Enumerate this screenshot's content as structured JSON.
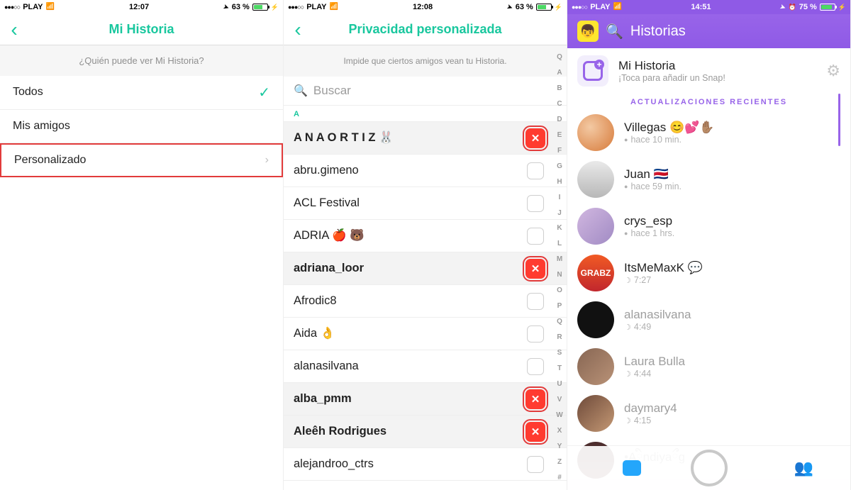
{
  "phone1": {
    "status": {
      "carrier": "PLAY",
      "time": "12:07",
      "battery_pct": "63 %",
      "battery_fill": 63
    },
    "nav_title": "Mi Historia",
    "subheader": "¿Quién puede ver Mi Historia?",
    "options": {
      "everyone": "Todos",
      "friends": "Mis amigos",
      "custom": "Personalizado"
    }
  },
  "phone2": {
    "status": {
      "carrier": "PLAY",
      "time": "12:08",
      "battery_pct": "63 %",
      "battery_fill": 63
    },
    "nav_title": "Privacidad personalizada",
    "subheader": "Impide que ciertos amigos vean tu Historia.",
    "search_placeholder": "Buscar",
    "section_letter": "A",
    "friends": [
      {
        "name": "A N A O R T I Z 🐰",
        "blocked": true,
        "highlight": true
      },
      {
        "name": "abru.gimeno",
        "blocked": false,
        "highlight": false
      },
      {
        "name": "ACL Festival",
        "blocked": false,
        "highlight": false
      },
      {
        "name": "ADRIA 🍎 🐻",
        "blocked": false,
        "highlight": false
      },
      {
        "name": "adriana_loor",
        "blocked": true,
        "highlight": true
      },
      {
        "name": "Afrodic8",
        "blocked": false,
        "highlight": false
      },
      {
        "name": "Aida 👌",
        "blocked": false,
        "highlight": false
      },
      {
        "name": "alanasilvana",
        "blocked": false,
        "highlight": false
      },
      {
        "name": "alba_pmm",
        "blocked": true,
        "highlight": true
      },
      {
        "name": "Aleêh Rodrigues",
        "blocked": true,
        "highlight": true
      },
      {
        "name": "alejandroo_ctrs",
        "blocked": false,
        "highlight": false
      }
    ],
    "index_chars": [
      "Q",
      "A",
      "B",
      "C",
      "D",
      "E",
      "F",
      "G",
      "H",
      "I",
      "J",
      "K",
      "L",
      "M",
      "N",
      "O",
      "P",
      "Q",
      "R",
      "S",
      "T",
      "U",
      "V",
      "W",
      "X",
      "Y",
      "Z",
      "#"
    ]
  },
  "phone3": {
    "status": {
      "carrier": "PLAY",
      "time": "14:51",
      "battery_pct": "75 %",
      "battery_fill": 75
    },
    "header_title": "Historias",
    "my_story": {
      "title": "Mi Historia",
      "subtitle": "¡Toca para añadir un Snap!"
    },
    "section_title": "ACTUALIZACIONES RECIENTES",
    "feed": [
      {
        "name": "Villegas 😊💕✋🏽",
        "sub": "hace 10 min.",
        "ind": "dot",
        "faded": false,
        "av": "av1"
      },
      {
        "name": "Juan 🇨🇷",
        "sub": "hace 59 min.",
        "ind": "dot",
        "faded": false,
        "av": "av2"
      },
      {
        "name": "crys_esp",
        "sub": "hace 1 hrs.",
        "ind": "dot",
        "faded": false,
        "av": "av3"
      },
      {
        "name": "ItsMeMaxK 💬",
        "sub": "7:27",
        "ind": "moon",
        "faded": false,
        "av": "av4"
      },
      {
        "name": "alanasilvana",
        "sub": "4:49",
        "ind": "moon",
        "faded": true,
        "av": "av5"
      },
      {
        "name": "Laura Bulla",
        "sub": "4:44",
        "ind": "moon",
        "faded": true,
        "av": "av6"
      },
      {
        "name": "daymary4",
        "sub": "4:15",
        "ind": "moon",
        "faded": true,
        "av": "av7"
      }
    ],
    "partial_last_name": "•Aིndiyaྀg"
  }
}
